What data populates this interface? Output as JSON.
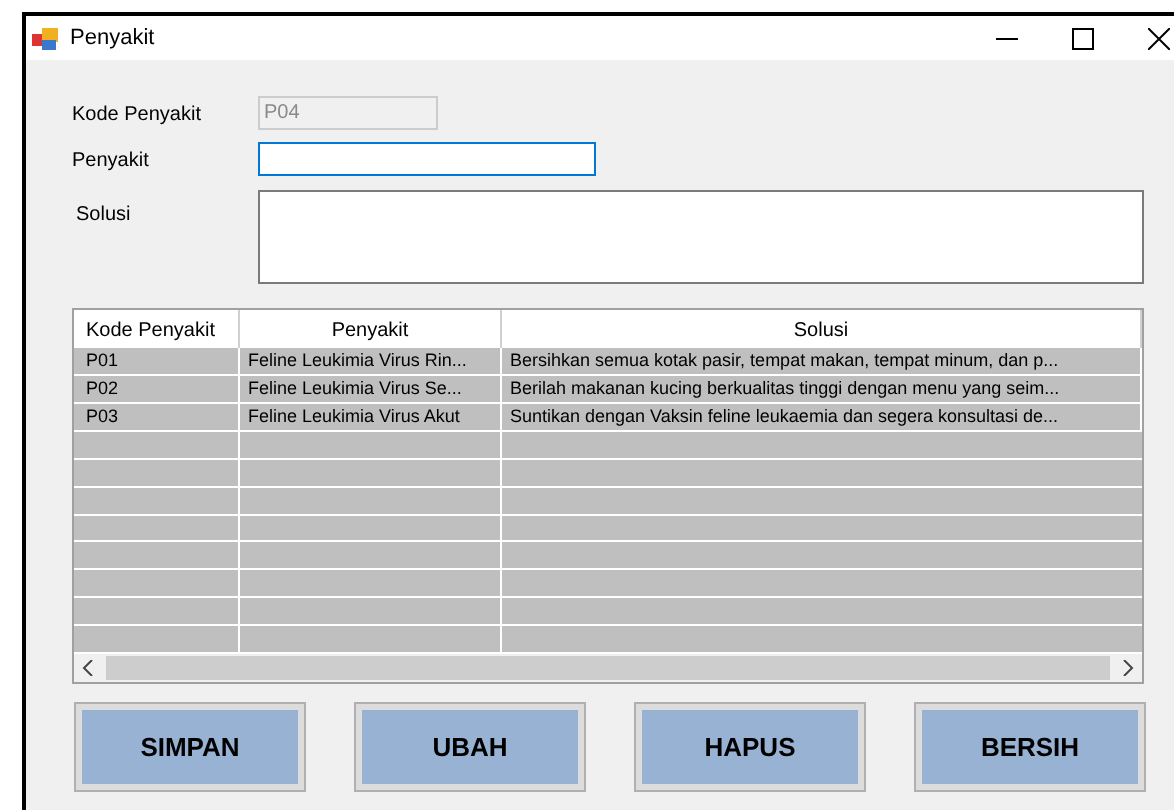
{
  "window": {
    "title": "Penyakit"
  },
  "form": {
    "fields": [
      {
        "label": "Kode Penyakit",
        "value": "P04",
        "disabled": true,
        "kind": "text"
      },
      {
        "label": "Penyakit",
        "disabled": false,
        "kind": "text"
      },
      {
        "label": "Solusi",
        "disabled": false,
        "kind": "multiline"
      }
    ]
  },
  "table": {
    "columns": [
      "Kode Penyakit",
      "Penyakit",
      "Solusi"
    ],
    "rows": [
      [
        "P01",
        "Feline Leukimia Virus Rin...",
        "Bersihkan semua kotak pasir, tempat makan, tempat minum, dan p..."
      ],
      [
        "P02",
        "Feline Leukimia Virus Se...",
        "Berilah makanan kucing berkualitas tinggi dengan menu yang seim..."
      ],
      [
        "P03",
        "Feline Leukimia Virus Akut",
        "Suntikan dengan Vaksin feline leukaemia dan segera konsultasi de..."
      ]
    ]
  },
  "buttons": [
    "SIMPAN",
    "UBAH",
    "HAPUS",
    "BERSIH"
  ]
}
